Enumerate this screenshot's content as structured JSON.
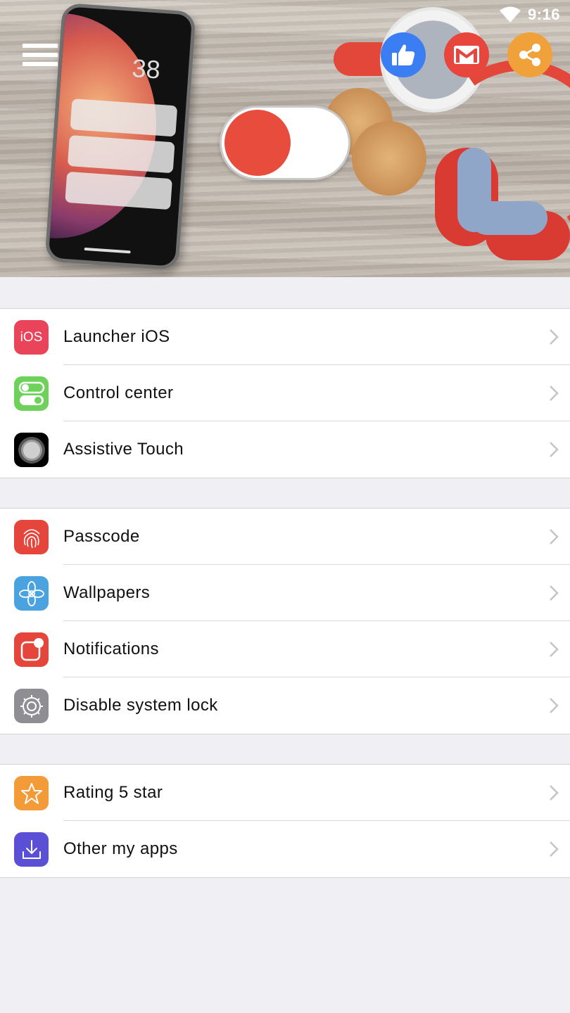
{
  "status_bar": {
    "time": "9:16"
  },
  "banner": {
    "phone_clock": "38",
    "toggle": {
      "on": false
    },
    "social": [
      "like-icon",
      "gmail-icon",
      "share-icon"
    ]
  },
  "colors": {
    "background": "#efeff4",
    "toggle_knob": "#e74c3c",
    "like": "#3b7ef3",
    "mail": "#e8453c",
    "share": "#f1a13a"
  },
  "groups": [
    {
      "items": [
        {
          "label": "Launcher iOS",
          "icon": "ios-icon",
          "icon_text": "iOS",
          "color": "#e9445a"
        },
        {
          "label": "Control center",
          "icon": "toggles-icon",
          "color": "#6ed25a"
        },
        {
          "label": "Assistive Touch",
          "icon": "assistive-touch-icon",
          "color": "#000000"
        }
      ]
    },
    {
      "items": [
        {
          "label": "Passcode",
          "icon": "fingerprint-icon",
          "color": "#e5453b"
        },
        {
          "label": "Wallpapers",
          "icon": "flower-icon",
          "color": "#4aa3df"
        },
        {
          "label": "Notifications",
          "icon": "notification-badge-icon",
          "color": "#e5453b"
        },
        {
          "label": "Disable system lock",
          "icon": "gear-icon",
          "color": "#8e8e93"
        }
      ]
    },
    {
      "items": [
        {
          "label": "Rating 5 star",
          "icon": "star-icon",
          "color": "#f29b38"
        },
        {
          "label": "Other my apps",
          "icon": "download-icon",
          "color": "#5b4fd6"
        }
      ]
    }
  ]
}
